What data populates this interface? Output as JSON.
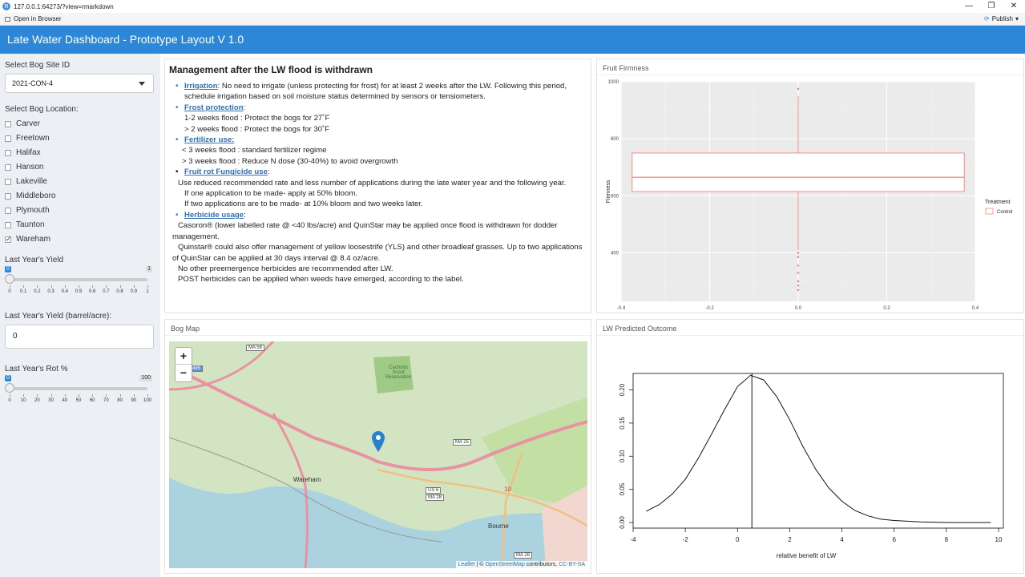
{
  "window": {
    "url": "127.0.0.1:64273/?view=rmarkdown",
    "open_in_browser": "Open in Browser",
    "publish": "Publish"
  },
  "header": {
    "title": "Late Water Dashboard - Prototype Layout V 1.0"
  },
  "sidebar": {
    "site_label": "Select Bog Site ID",
    "site_value": "2021-CON-4",
    "location_label": "Select Bog Location:",
    "locations": [
      {
        "name": "Carver",
        "checked": false
      },
      {
        "name": "Freetown",
        "checked": false
      },
      {
        "name": "Halifax",
        "checked": false
      },
      {
        "name": "Hanson",
        "checked": false
      },
      {
        "name": "Lakeville",
        "checked": false
      },
      {
        "name": "Middleboro",
        "checked": false
      },
      {
        "name": "Plymouth",
        "checked": false
      },
      {
        "name": "Taunton",
        "checked": false
      },
      {
        "name": "Wareham",
        "checked": true
      }
    ],
    "yield_label": "Last Year's Yield",
    "yield_slider": {
      "min": "0",
      "max": "1",
      "value": 0,
      "ticks": [
        "0",
        "0.1",
        "0.2",
        "0.3",
        "0.4",
        "0.5",
        "0.6",
        "0.7",
        "0.8",
        "0.9",
        "1"
      ]
    },
    "yield_input_label": "Last Year's Yield (barrel/acre):",
    "yield_input_value": "0",
    "rot_label": "Last Year's Rot %",
    "rot_slider": {
      "min": "0",
      "max": "100",
      "value": 0,
      "ticks": [
        "0",
        "10",
        "20",
        "30",
        "40",
        "50",
        "60",
        "70",
        "80",
        "90",
        "100"
      ]
    }
  },
  "management": {
    "title": "Management after the LW flood is withdrawn",
    "irrigation_link": "Irrigation",
    "irrigation_text": ": No need to irrigate (unless protecting for frost) for at least 2 weeks after the LW. Following this period, schedule irrigation based on soil moisture status determined by sensors or tensiometers.",
    "frost_link": "Frost protection",
    "frost_lines": [
      "1-2 weeks flood : Protect the bogs for 27˚F",
      "> 2 weeks flood : Protect the bogs for 30˚F"
    ],
    "fert_link": "Fertilizer use:",
    "fert_lines": [
      "< 3 weeks flood : standard fertilizer regime",
      "> 3 weeks flood : Reduce N dose (30-40%) to avoid overgrowth"
    ],
    "fung_link": "Fruit rot Fungicide use",
    "fung_lines": [
      "Use reduced recommended rate and less number of applications during the late water year and the following year.",
      "If one application to be made- apply at 50% bloom.",
      "If two applications are to be made- at 10% bloom and two weeks later."
    ],
    "herb_link": "Herbicide usage",
    "herb_lines": [
      "Casoron® (lower labelled rate @ <40 lbs/acre) and QuinStar may be applied once flood is withdrawn for dodder management.",
      "Quinstar® could also offer management of yellow loosestrife (YLS) and other broadleaf grasses. Up to two applications of QuinStar can be applied at 30 days interval @ 8.4 oz/acre.",
      "No other preemergence herbicides are recommended after LW.",
      "POST herbicides can be applied when weeds have emerged, according to the label."
    ]
  },
  "firmness": {
    "panel_title": "Fruit Firmness",
    "chart_data": {
      "type": "boxplot",
      "ylabel": "Firmness",
      "xlabel": "",
      "xlim": [
        -0.4,
        0.4
      ],
      "ylim": [
        230,
        1000
      ],
      "xticks": [
        "-0.4",
        "-0.2",
        "0.0",
        "0.2",
        "0.4"
      ],
      "yticks": [
        "400",
        "600",
        "800",
        "1000"
      ],
      "legend_title": "Treatment",
      "series": [
        {
          "name": "Control",
          "q1": 615,
          "median": 665,
          "q3": 750,
          "outliers": [
            975,
            400,
            385,
            355,
            330,
            300,
            285,
            270
          ]
        }
      ],
      "color": "#f8766d"
    }
  },
  "map": {
    "panel_title": "Bog Map",
    "zoom_in": "+",
    "zoom_out": "−",
    "labels": {
      "wareham": "Wareham",
      "bourne": "Bourne",
      "reservation": "Cacholot Scout Reservation",
      "ma58": "MA 58",
      "ma25": "MA 25",
      "us6": "US 6",
      "ma28": "MA 28",
      "ma28b": "MA 28",
      "i495": "495",
      "n10": "10"
    },
    "attribution": {
      "leaflet": "Leaflet",
      "sep": " | © ",
      "osm": "OpenStreetMap",
      "contrib": " contributors, ",
      "cc": "CC-BY-SA"
    }
  },
  "outcome": {
    "panel_title": "LW Predicted Outcome",
    "chart_data": {
      "type": "line",
      "xlabel": "relative benefit of LW",
      "ylabel": "",
      "xlim": [
        -4,
        10
      ],
      "ylim": [
        0,
        0.22
      ],
      "xticks": [
        "-4",
        "-2",
        "0",
        "2",
        "4",
        "6",
        "8",
        "10"
      ],
      "yticks": [
        "0.00",
        "0.05",
        "0.10",
        "0.15",
        "0.20"
      ],
      "vline": 0.55,
      "series": [
        {
          "x": [
            -3.5,
            -3,
            -2.5,
            -2,
            -1.5,
            -1,
            -0.5,
            0,
            0.5,
            1,
            1.5,
            2,
            2.5,
            3,
            3.5,
            4,
            4.5,
            5,
            5.5,
            6,
            7,
            8,
            9,
            9.7
          ],
          "y": [
            0.017,
            0.027,
            0.043,
            0.065,
            0.097,
            0.133,
            0.17,
            0.205,
            0.222,
            0.215,
            0.19,
            0.155,
            0.115,
            0.08,
            0.052,
            0.032,
            0.018,
            0.01,
            0.005,
            0.003,
            0.001,
            0.0,
            0.0,
            0.0
          ]
        }
      ]
    }
  }
}
